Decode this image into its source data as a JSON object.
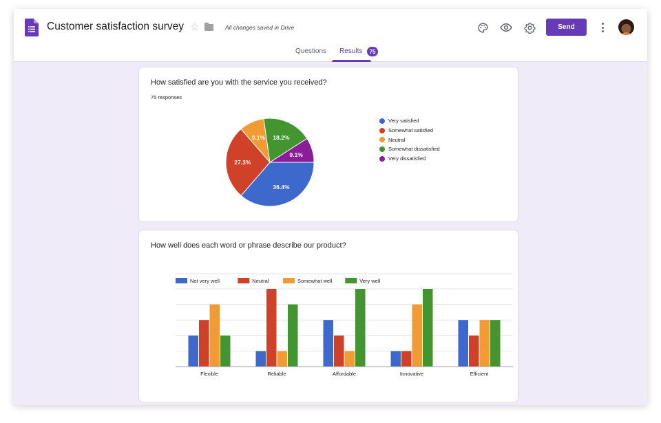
{
  "app": {
    "title": "Customer satisfaction survey",
    "save_status": "All changes saved in Drive",
    "icons": {
      "logo": "google-forms-icon",
      "star": "star-icon",
      "folder": "folder-icon",
      "palette": "palette-icon",
      "preview": "eye-icon",
      "settings": "gear-icon",
      "more": "more-vert-icon"
    },
    "send_label": "Send",
    "accent_color": "#673ab7"
  },
  "tabs": [
    {
      "label": "Questions",
      "active": false
    },
    {
      "label": "Results",
      "active": true,
      "badge": "75"
    }
  ],
  "questions": [
    {
      "title": "How satisfied are you with the service you received?",
      "responses_label": "75 responses"
    },
    {
      "title": "How well does each word or phrase describe our product?"
    }
  ],
  "chart_data": [
    {
      "type": "pie",
      "title": "How satisfied are you with the service you received?",
      "labels": [
        "Very satisfied",
        "Somewhat satisfied",
        "Neutral",
        "Somewhat dissatisfied",
        "Very dissatisfied"
      ],
      "values": [
        36.4,
        27.3,
        9.1,
        18.2,
        9.1
      ],
      "value_labels": [
        "36.4%",
        "27.3%",
        "9.1%",
        "18.2%",
        "9.1%"
      ],
      "colors": [
        "#3e69cc",
        "#d0412a",
        "#f29b34",
        "#43952f",
        "#8c1d99"
      ],
      "start_angle_deg": 90,
      "direction": "clockwise",
      "legend": "right"
    },
    {
      "type": "bar",
      "title": "How well does each word or phrase describe our product?",
      "categories": [
        "Flexible",
        "Reliable",
        "Affordable",
        "Innovative",
        "Efficient"
      ],
      "series": [
        {
          "name": "Not very well",
          "color": "#3e69cc",
          "values": [
            2,
            1,
            3,
            1,
            3
          ]
        },
        {
          "name": "Neutral",
          "color": "#d0412a",
          "values": [
            3,
            5,
            2,
            1,
            2
          ]
        },
        {
          "name": "Somewhat well",
          "color": "#f29b34",
          "values": [
            4,
            1,
            1,
            4,
            3
          ]
        },
        {
          "name": "Very well",
          "color": "#43952f",
          "values": [
            2,
            4,
            5,
            5,
            3
          ]
        }
      ],
      "ylim": [
        0,
        6
      ],
      "grid": true,
      "legend": "top-left",
      "xlabel": "",
      "ylabel": ""
    }
  ]
}
